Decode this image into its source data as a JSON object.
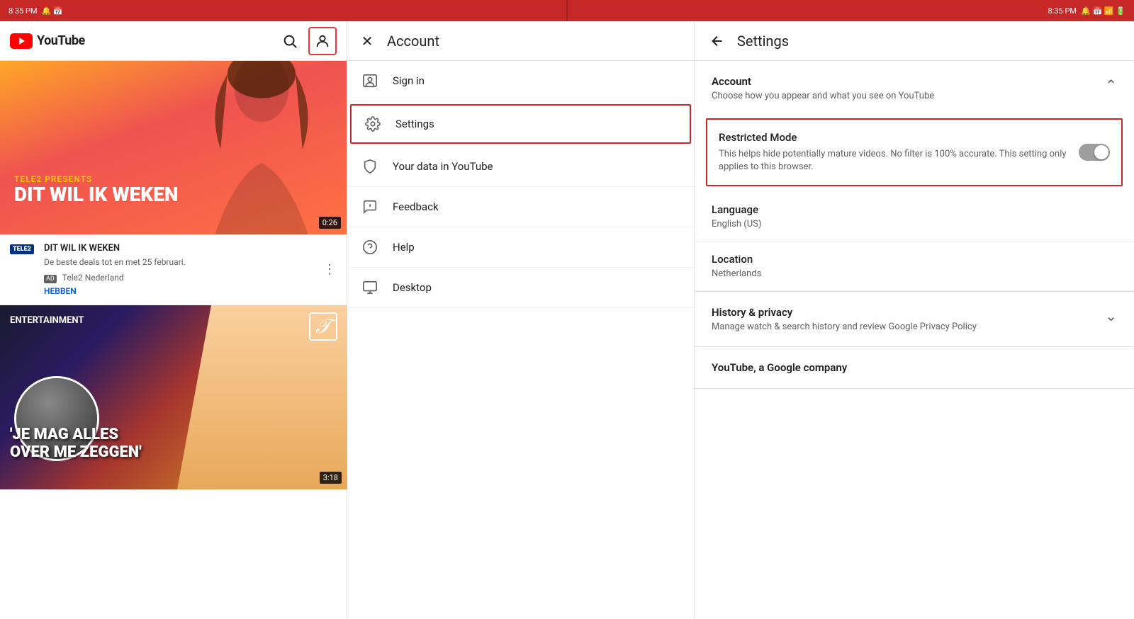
{
  "statusBar": {
    "time": "8:35 PM",
    "icons": "🔔 📅 📶 🔋"
  },
  "leftPanel": {
    "logo": "YouTube",
    "featuredVideo": {
      "titleSmall": "TELE2 PRESENTS",
      "titleLarge": "DIT WIL IK WEKEN",
      "duration": "0:26"
    },
    "videoCard": {
      "channelName": "TELE2",
      "title": "DIT WIL IK WEKEN",
      "meta": "De beste deals tot en met 25 februari.",
      "adBadge": "AD",
      "channel": "Tele2 Nederland",
      "cta": "HEBBEN"
    },
    "secondVideo": {
      "badge": "ENTERTAINMENT",
      "titleLine1": "'JE MAG ALLES",
      "titleLine2": "OVER ME ZEGGEN'",
      "duration": "3:18"
    }
  },
  "middlePanel": {
    "title": "Account",
    "menuItems": [
      {
        "id": "sign-in",
        "label": "Sign in",
        "icon": "person"
      },
      {
        "id": "settings",
        "label": "Settings",
        "icon": "gear",
        "highlighted": true
      },
      {
        "id": "your-data",
        "label": "Your data in YouTube",
        "icon": "shield"
      },
      {
        "id": "feedback",
        "label": "Feedback",
        "icon": "feedback"
      },
      {
        "id": "help",
        "label": "Help",
        "icon": "help"
      },
      {
        "id": "desktop",
        "label": "Desktop",
        "icon": "desktop"
      }
    ]
  },
  "rightPanel": {
    "title": "Settings",
    "sections": {
      "account": {
        "title": "Account",
        "subtitle": "Choose how you appear and what you see on YouTube",
        "expanded": true,
        "restrictedMode": {
          "title": "Restricted Mode",
          "description": "This helps hide potentially mature videos. No filter is 100% accurate. This setting only applies to this browser.",
          "enabled": false
        },
        "language": {
          "label": "Language",
          "value": "English (US)"
        },
        "location": {
          "label": "Location",
          "value": "Netherlands"
        }
      },
      "history": {
        "title": "History & privacy",
        "subtitle": "Manage watch & search history and review Google Privacy Policy",
        "expanded": false
      },
      "company": {
        "text": "YouTube, a Google company"
      }
    }
  }
}
